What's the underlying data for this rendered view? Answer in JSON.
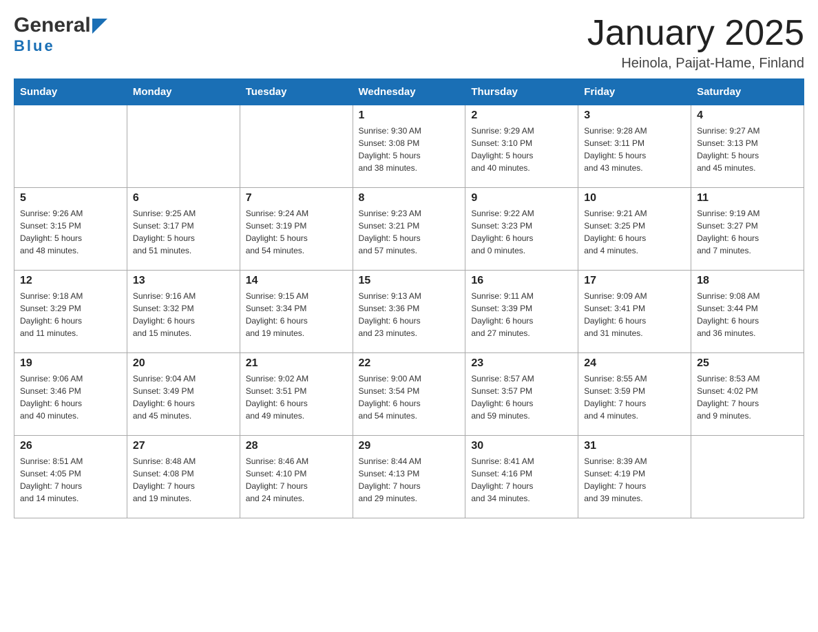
{
  "header": {
    "logo_general": "General",
    "logo_blue": "Blue",
    "month_title": "January 2025",
    "location": "Heinola, Paijat-Hame, Finland"
  },
  "days_of_week": [
    "Sunday",
    "Monday",
    "Tuesday",
    "Wednesday",
    "Thursday",
    "Friday",
    "Saturday"
  ],
  "weeks": [
    [
      {
        "day": "",
        "info": ""
      },
      {
        "day": "",
        "info": ""
      },
      {
        "day": "",
        "info": ""
      },
      {
        "day": "1",
        "info": "Sunrise: 9:30 AM\nSunset: 3:08 PM\nDaylight: 5 hours\nand 38 minutes."
      },
      {
        "day": "2",
        "info": "Sunrise: 9:29 AM\nSunset: 3:10 PM\nDaylight: 5 hours\nand 40 minutes."
      },
      {
        "day": "3",
        "info": "Sunrise: 9:28 AM\nSunset: 3:11 PM\nDaylight: 5 hours\nand 43 minutes."
      },
      {
        "day": "4",
        "info": "Sunrise: 9:27 AM\nSunset: 3:13 PM\nDaylight: 5 hours\nand 45 minutes."
      }
    ],
    [
      {
        "day": "5",
        "info": "Sunrise: 9:26 AM\nSunset: 3:15 PM\nDaylight: 5 hours\nand 48 minutes."
      },
      {
        "day": "6",
        "info": "Sunrise: 9:25 AM\nSunset: 3:17 PM\nDaylight: 5 hours\nand 51 minutes."
      },
      {
        "day": "7",
        "info": "Sunrise: 9:24 AM\nSunset: 3:19 PM\nDaylight: 5 hours\nand 54 minutes."
      },
      {
        "day": "8",
        "info": "Sunrise: 9:23 AM\nSunset: 3:21 PM\nDaylight: 5 hours\nand 57 minutes."
      },
      {
        "day": "9",
        "info": "Sunrise: 9:22 AM\nSunset: 3:23 PM\nDaylight: 6 hours\nand 0 minutes."
      },
      {
        "day": "10",
        "info": "Sunrise: 9:21 AM\nSunset: 3:25 PM\nDaylight: 6 hours\nand 4 minutes."
      },
      {
        "day": "11",
        "info": "Sunrise: 9:19 AM\nSunset: 3:27 PM\nDaylight: 6 hours\nand 7 minutes."
      }
    ],
    [
      {
        "day": "12",
        "info": "Sunrise: 9:18 AM\nSunset: 3:29 PM\nDaylight: 6 hours\nand 11 minutes."
      },
      {
        "day": "13",
        "info": "Sunrise: 9:16 AM\nSunset: 3:32 PM\nDaylight: 6 hours\nand 15 minutes."
      },
      {
        "day": "14",
        "info": "Sunrise: 9:15 AM\nSunset: 3:34 PM\nDaylight: 6 hours\nand 19 minutes."
      },
      {
        "day": "15",
        "info": "Sunrise: 9:13 AM\nSunset: 3:36 PM\nDaylight: 6 hours\nand 23 minutes."
      },
      {
        "day": "16",
        "info": "Sunrise: 9:11 AM\nSunset: 3:39 PM\nDaylight: 6 hours\nand 27 minutes."
      },
      {
        "day": "17",
        "info": "Sunrise: 9:09 AM\nSunset: 3:41 PM\nDaylight: 6 hours\nand 31 minutes."
      },
      {
        "day": "18",
        "info": "Sunrise: 9:08 AM\nSunset: 3:44 PM\nDaylight: 6 hours\nand 36 minutes."
      }
    ],
    [
      {
        "day": "19",
        "info": "Sunrise: 9:06 AM\nSunset: 3:46 PM\nDaylight: 6 hours\nand 40 minutes."
      },
      {
        "day": "20",
        "info": "Sunrise: 9:04 AM\nSunset: 3:49 PM\nDaylight: 6 hours\nand 45 minutes."
      },
      {
        "day": "21",
        "info": "Sunrise: 9:02 AM\nSunset: 3:51 PM\nDaylight: 6 hours\nand 49 minutes."
      },
      {
        "day": "22",
        "info": "Sunrise: 9:00 AM\nSunset: 3:54 PM\nDaylight: 6 hours\nand 54 minutes."
      },
      {
        "day": "23",
        "info": "Sunrise: 8:57 AM\nSunset: 3:57 PM\nDaylight: 6 hours\nand 59 minutes."
      },
      {
        "day": "24",
        "info": "Sunrise: 8:55 AM\nSunset: 3:59 PM\nDaylight: 7 hours\nand 4 minutes."
      },
      {
        "day": "25",
        "info": "Sunrise: 8:53 AM\nSunset: 4:02 PM\nDaylight: 7 hours\nand 9 minutes."
      }
    ],
    [
      {
        "day": "26",
        "info": "Sunrise: 8:51 AM\nSunset: 4:05 PM\nDaylight: 7 hours\nand 14 minutes."
      },
      {
        "day": "27",
        "info": "Sunrise: 8:48 AM\nSunset: 4:08 PM\nDaylight: 7 hours\nand 19 minutes."
      },
      {
        "day": "28",
        "info": "Sunrise: 8:46 AM\nSunset: 4:10 PM\nDaylight: 7 hours\nand 24 minutes."
      },
      {
        "day": "29",
        "info": "Sunrise: 8:44 AM\nSunset: 4:13 PM\nDaylight: 7 hours\nand 29 minutes."
      },
      {
        "day": "30",
        "info": "Sunrise: 8:41 AM\nSunset: 4:16 PM\nDaylight: 7 hours\nand 34 minutes."
      },
      {
        "day": "31",
        "info": "Sunrise: 8:39 AM\nSunset: 4:19 PM\nDaylight: 7 hours\nand 39 minutes."
      },
      {
        "day": "",
        "info": ""
      }
    ]
  ]
}
